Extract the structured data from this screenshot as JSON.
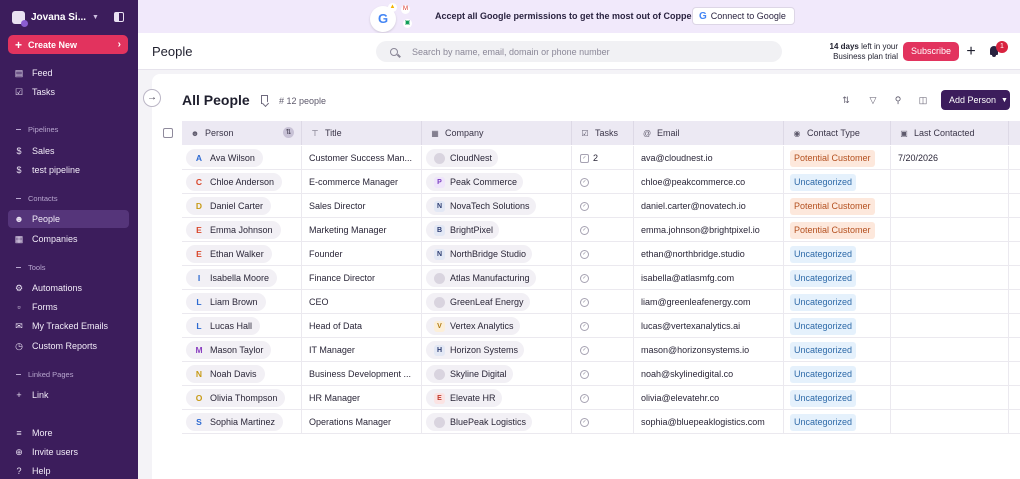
{
  "sidebar": {
    "workspace_name": "Jovana Si...",
    "create_label": "Create New",
    "items": {
      "feed": "Feed",
      "tasks": "Tasks",
      "pipelines_header": "Pipelines",
      "sales": "Sales",
      "test_pipeline": "test pipeline",
      "contacts_header": "Contacts",
      "people": "People",
      "companies": "Companies",
      "tools_header": "Tools",
      "automations": "Automations",
      "forms": "Forms",
      "tracked_emails": "My Tracked Emails",
      "custom_reports": "Custom Reports",
      "linked_header": "Linked Pages",
      "link": "Link",
      "more": "More",
      "invite": "Invite users",
      "help": "Help"
    }
  },
  "banner": {
    "text": "Accept all Google permissions to get the most out of Copper.",
    "connect_label": "Connect to Google"
  },
  "topbar": {
    "title": "People",
    "search_placeholder": "Search by name, email, domain or phone number",
    "trial_days": "14 days",
    "trial_rest": "left in your",
    "trial_plan": "Business plan trial",
    "subscribe_label": "Subscribe",
    "notification_count": "1"
  },
  "list": {
    "title": "All People",
    "count": "12 people",
    "add_label": "Add Person"
  },
  "table": {
    "columns": {
      "person": "Person",
      "title": "Title",
      "company": "Company",
      "tasks": "Tasks",
      "email": "Email",
      "contact_type": "Contact Type",
      "last_contacted": "Last Contacted"
    },
    "rows": [
      {
        "initial": "A",
        "name": "Ava Wilson",
        "title": "Customer Success Man...",
        "company": "CloudNest",
        "tasks": "2",
        "email": "ava@cloudnest.io",
        "type": "Potential Customer",
        "last": "7/20/2026"
      },
      {
        "initial": "C",
        "name": "Chloe Anderson",
        "title": "E-commerce Manager",
        "company": "Peak Commerce",
        "tasks": "",
        "email": "chloe@peakcommerce.co",
        "type": "Uncategorized",
        "last": ""
      },
      {
        "initial": "D",
        "name": "Daniel Carter",
        "title": "Sales Director",
        "company": "NovaTech Solutions",
        "tasks": "",
        "email": "daniel.carter@novatech.io",
        "type": "Potential Customer",
        "last": ""
      },
      {
        "initial": "E",
        "name": "Emma Johnson",
        "title": "Marketing Manager",
        "company": "BrightPixel",
        "tasks": "",
        "email": "emma.johnson@brightpixel.io",
        "type": "Potential Customer",
        "last": ""
      },
      {
        "initial": "E",
        "name": "Ethan Walker",
        "title": "Founder",
        "company": "NorthBridge Studio",
        "tasks": "",
        "email": "ethan@northbridge.studio",
        "type": "Uncategorized",
        "last": ""
      },
      {
        "initial": "I",
        "name": "Isabella Moore",
        "title": "Finance Director",
        "company": "Atlas Manufacturing",
        "tasks": "",
        "email": "isabella@atlasmfg.com",
        "type": "Uncategorized",
        "last": ""
      },
      {
        "initial": "L",
        "name": "Liam Brown",
        "title": "CEO",
        "company": "GreenLeaf Energy",
        "tasks": "",
        "email": "liam@greenleafenergy.com",
        "type": "Uncategorized",
        "last": ""
      },
      {
        "initial": "L",
        "name": "Lucas Hall",
        "title": "Head of Data",
        "company": "Vertex Analytics",
        "tasks": "",
        "email": "lucas@vertexanalytics.ai",
        "type": "Uncategorized",
        "last": ""
      },
      {
        "initial": "M",
        "name": "Mason Taylor",
        "title": "IT Manager",
        "company": "Horizon Systems",
        "tasks": "",
        "email": "mason@horizonsystems.io",
        "type": "Uncategorized",
        "last": ""
      },
      {
        "initial": "N",
        "name": "Noah Davis",
        "title": "Business Development ...",
        "company": "Skyline Digital",
        "tasks": "",
        "email": "noah@skylinedigital.co",
        "type": "Uncategorized",
        "last": ""
      },
      {
        "initial": "O",
        "name": "Olivia Thompson",
        "title": "HR Manager",
        "company": "Elevate HR",
        "tasks": "",
        "email": "olivia@elevatehr.co",
        "type": "Uncategorized",
        "last": ""
      },
      {
        "initial": "S",
        "name": "Sophia Martinez",
        "title": "Operations Manager",
        "company": "BluePeak Logistics",
        "tasks": "",
        "email": "sophia@bluepeaklogistics.com",
        "type": "Uncategorized",
        "last": ""
      }
    ]
  },
  "company_badges": {
    "Peak Commerce": "P",
    "NovaTech Solutions": "N",
    "BrightPixel": "B",
    "NorthBridge Studio": "N",
    "Vertex Analytics": "V",
    "Horizon Systems": "H",
    "Elevate HR": "E"
  },
  "colors": {
    "sidebar_bg": "#3c1d5c",
    "accent_pink": "#e2335e",
    "banner_bg": "#f1e9fb",
    "header_bg": "#ece9f3"
  }
}
